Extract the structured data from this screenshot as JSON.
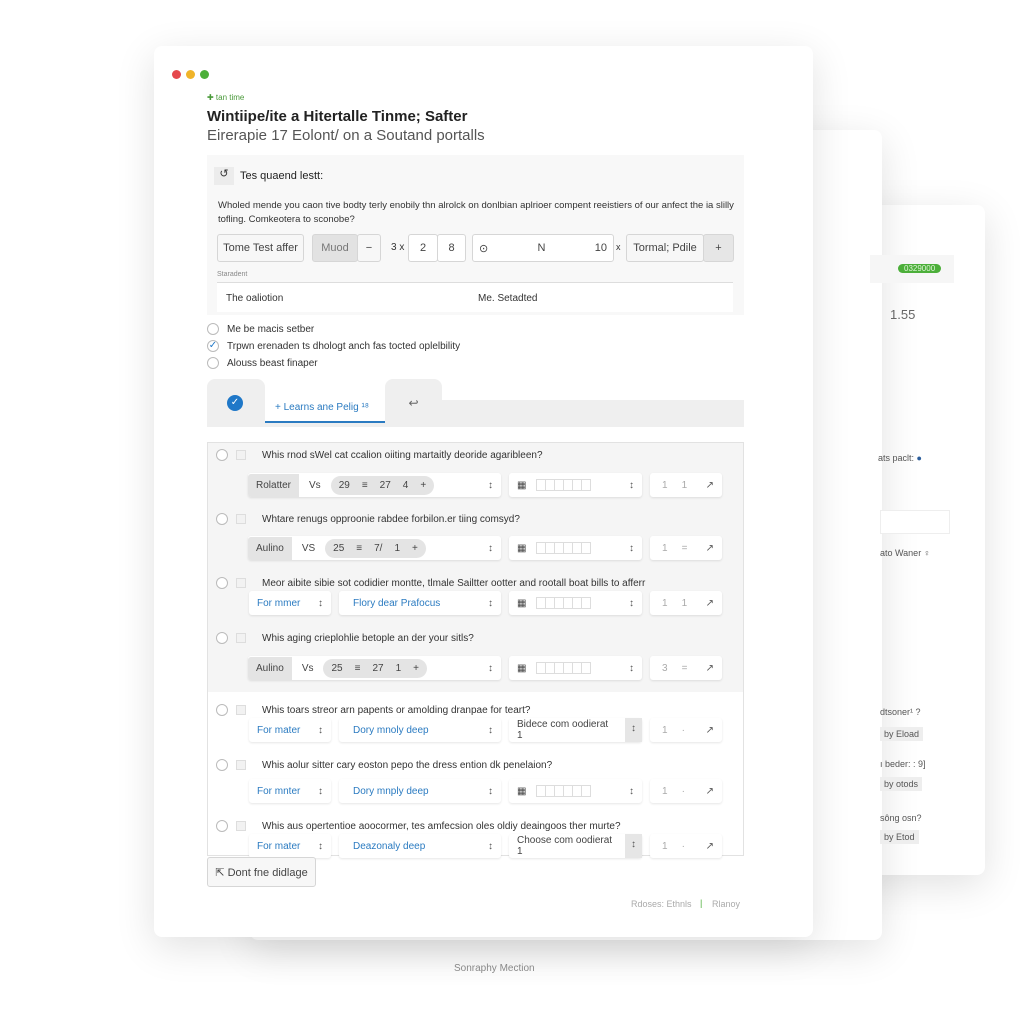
{
  "window": {
    "breadcrumb": "✚ tan time",
    "title": "Wintiipe/ite a Hitertalle Tinme; Safter",
    "subtitle": "Eirerapie 17 Eolont/ on a Soutand portalls"
  },
  "panel": {
    "heading": "Tes quaend lestt:",
    "description": "Wholed mende you caon tive bodty terly enobily thn alrolck on donlbian aplrioer compent reeistiers of our anfect the ia slilly tofling. Comkeotera to sconobe?",
    "toolbar": {
      "b1": "Tome Test affer",
      "b2": "Muod",
      "b3": "−",
      "t1": "3 x",
      "n1": "2",
      "n2": "8",
      "g1": "⊙",
      "g2": "N",
      "g3": "10",
      "t2": "x",
      "b4": "Tormal; Pdile",
      "b5": "+"
    },
    "label": "Staradent",
    "field_left": "The oaliotion",
    "field_right": "Me. Setadted"
  },
  "options": [
    {
      "label": "Me be macis setber",
      "checked": false
    },
    {
      "label": "Trpwn erenaden ts dhologt anch fas tocted oplelbility",
      "checked": true
    },
    {
      "label": "Alouss beast finaper",
      "checked": false
    }
  ],
  "tabs": {
    "active": "+ Learns ane Pelig ¹⁸",
    "other_icon": "undo-icon"
  },
  "rows": [
    {
      "q": "Whis rnod sWel cat ccalion oiiting martaitly deoride agaribleen?",
      "type": "A",
      "a": "Rolatter",
      "vs": "Vs",
      "n": [
        "29",
        "≡",
        "27",
        "4",
        "+"
      ],
      "c3": [
        "1",
        "1"
      ]
    },
    {
      "q": "Whtare renugs opproonie rabdee forbilon.er tiing comsyd?",
      "type": "A",
      "a": "Aulino",
      "vs": "VS",
      "n": [
        "25",
        "≡",
        "7/",
        "1",
        "+"
      ],
      "c3": [
        "1",
        "="
      ]
    },
    {
      "q": "Meor aibite sibie sot codidier montte, tlmale Sailtter ootter and rootall boat bills to afferr",
      "type": "B",
      "a": "For mmer",
      "b": "Flory dear Prafocus",
      "c3": [
        "1",
        "1"
      ]
    },
    {
      "q": "Whis aging crieplohlie betople an der your sitls?",
      "type": "A",
      "a": "Aulino",
      "vs": "Vs",
      "n": [
        "25",
        "≡",
        "27",
        "1",
        "+"
      ],
      "c3": [
        "3",
        "="
      ]
    },
    {
      "q": "Whis toars streor arn papents or amolding dranpae for teart?",
      "type": "B",
      "a": "For mater",
      "b": "Dory mnoly deep",
      "c2": "Bidece com oodierat 1",
      "c3": [
        "1",
        "·"
      ]
    },
    {
      "q": "Whis aolur sitter cary eoston pepo the dress ention dk penelaion?",
      "type": "B",
      "a": "For mnter",
      "b": "Dory mnply deep",
      "c3": [
        "1",
        "·"
      ]
    },
    {
      "q": "Whis aus opertentioe aoocormer, tes amfecsion oles oldiy deaingoos ther murte?",
      "type": "B",
      "a": "For mater",
      "b": "Deazonaly deep",
      "c2": "Choose com oodierat 1",
      "c3": [
        "1",
        "·"
      ]
    }
  ],
  "footer": {
    "button": "⇱ Dont fne didlage",
    "links": [
      "Rdoses: Ethnls",
      "Rlanoy"
    ]
  },
  "back_card": {
    "badge": "0329000",
    "value": "1.55",
    "label1": "ats paclt:",
    "label2": "ato Waner ♀",
    "items": [
      "dtsoner¹ ?",
      "ı beder: : 9]",
      "sông osn?"
    ],
    "item_sub": [
      "by Eload",
      "by otods",
      "by Etod"
    ]
  },
  "caption": "Sonraphy Mection",
  "colors": {
    "accent": "#2b7bc1",
    "badge": "#4caf3a"
  }
}
